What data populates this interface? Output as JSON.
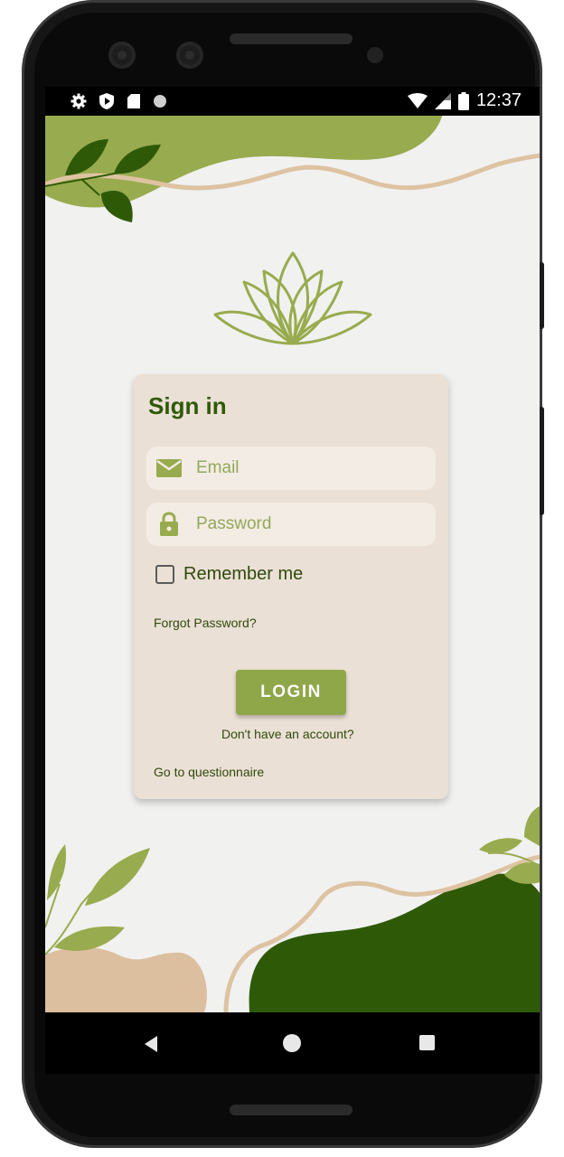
{
  "status_bar": {
    "time": "12:37",
    "left_icons": [
      "settings-icon",
      "shield-play-icon",
      "sd-card-icon",
      "dot-icon"
    ],
    "right_icons": [
      "wifi-icon",
      "signal-icon",
      "battery-icon"
    ]
  },
  "logo": {
    "icon": "lotus-icon"
  },
  "signin": {
    "title": "Sign in",
    "email_placeholder": "Email",
    "password_placeholder": "Password",
    "remember_label": "Remember me",
    "remember_checked": false,
    "forgot_password": "Forgot Password?",
    "login_label": "LOGIN",
    "no_account": "Don't have an account?",
    "questionnaire": "Go to questionnaire"
  },
  "nav_bar": {
    "icons": [
      "back-icon",
      "home-icon",
      "recents-icon"
    ]
  },
  "colors": {
    "primary_green": "#8fa748",
    "dark_green": "#2e5a08",
    "card_bg": "#ebe0d5",
    "screen_bg": "#f1f1f0",
    "beige": "#dcbf9f"
  }
}
